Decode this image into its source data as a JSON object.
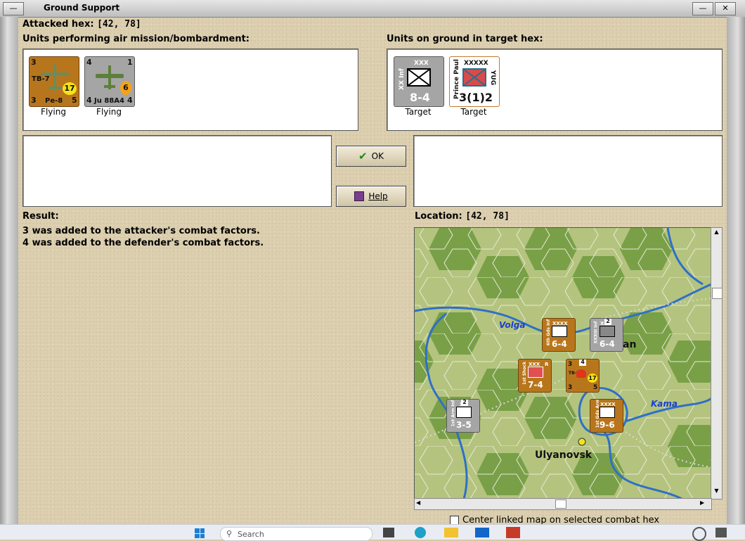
{
  "window": {
    "title": "Ground Support"
  },
  "attacked": {
    "label": "Attacked hex:",
    "value": "[42, 78]"
  },
  "air_units": {
    "heading": "Units performing air mission/bombardment:",
    "units": [
      {
        "name": "Pe-8",
        "type_label": "TB-7",
        "top_left": "3",
        "bottom_left": "3",
        "bottom_right": "5",
        "badge": "17",
        "status": "Flying",
        "color": "#b8761c"
      },
      {
        "name": "Ju 88A4",
        "top_left": "4",
        "top_right": "1",
        "bottom_left": "4",
        "bottom_right": "4",
        "badge": "6",
        "status": "Flying",
        "color": "#a5a5a5"
      }
    ]
  },
  "ground_units": {
    "heading": "Units on ground in target hex:",
    "units": [
      {
        "name": "XX Inf",
        "size": "XXX",
        "strength": "8-4",
        "status": "Target",
        "color": "#a5a5a5"
      },
      {
        "name": "Prince Paul",
        "size": "XXXXX",
        "nation": "YUG",
        "strength": "3(1)2",
        "status": "Target",
        "color": "#ffffff"
      }
    ]
  },
  "buttons": {
    "ok": "OK",
    "help": "Help"
  },
  "result": {
    "label": "Result:",
    "lines": [
      "3 was added to the attacker's combat factors.",
      "4 was added to the defender's combat factors."
    ]
  },
  "location": {
    "label": "Location:",
    "value": "[42, 78]"
  },
  "map": {
    "places": {
      "volga": "Volga",
      "kama": "Kama",
      "ulyanovsk": "Ulyanovsk",
      "kazan_partial": "an"
    },
    "counters": [
      {
        "name": "6th Gds Inf",
        "size": "XXXX",
        "strength": "6-4",
        "color": "#b8761c"
      },
      {
        "name": "XXXIII Inf",
        "size": "XXX",
        "strength": "6-4",
        "stack": "2",
        "color": "#a5a5a5"
      },
      {
        "name": "1st Shock",
        "size": "XXX",
        "strength": "7-4",
        "corner": "R",
        "color": "#b8761c"
      },
      {
        "name": "TB-7",
        "stack": "4",
        "top_left": "3",
        "bottom_left": "3",
        "bottom_right": "5",
        "badge": "17",
        "color": "#b8761c"
      },
      {
        "name": "1st Arm Inf",
        "size": "XX",
        "strength": "3-5",
        "stack": "2",
        "color": "#a5a5a5"
      },
      {
        "name": "1st Gds Arm",
        "size": "XXXX",
        "strength": "9-6",
        "color": "#b8761c"
      }
    ]
  },
  "options": {
    "center_map": "Center linked map on selected combat hex"
  },
  "taskbar": {
    "search_placeholder": "Search"
  },
  "colors": {
    "axis": "#a5a5a5",
    "soviet": "#b8761c",
    "river": "#2f6fc8"
  }
}
